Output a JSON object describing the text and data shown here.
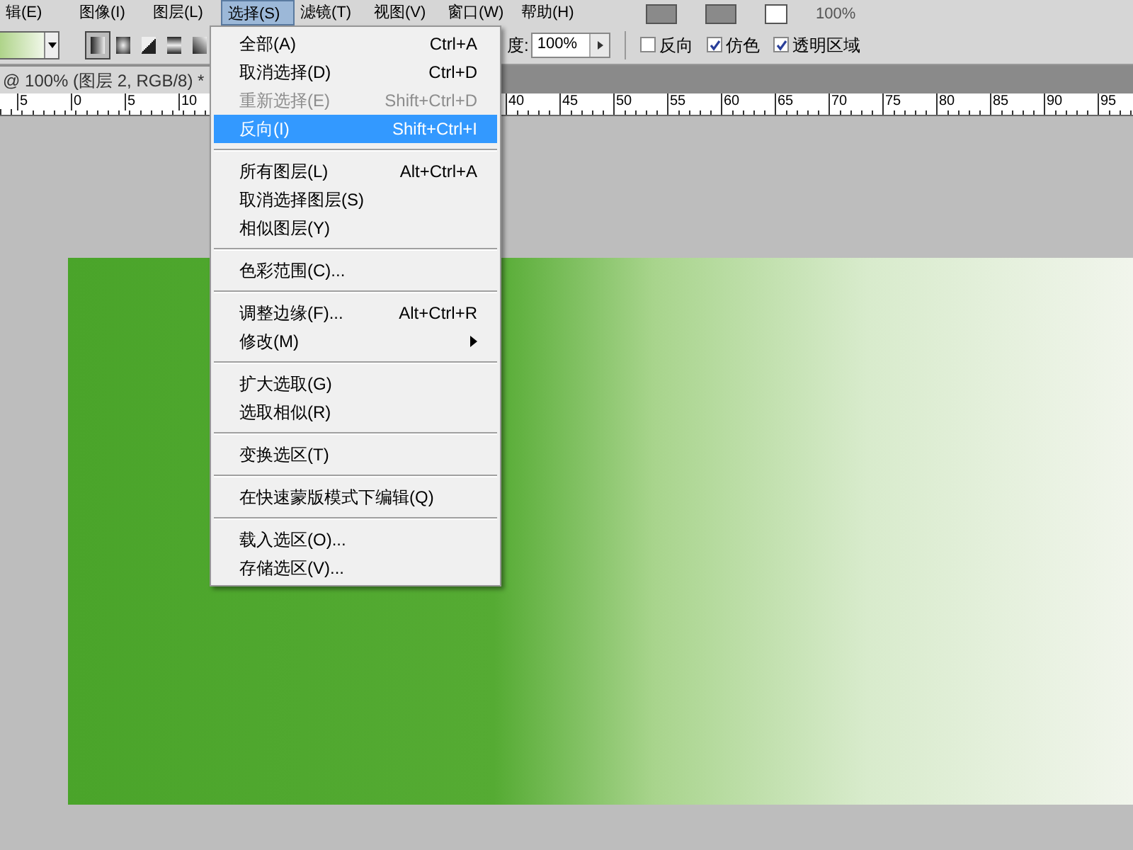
{
  "menu_bar": [
    {
      "label": "辑(E)",
      "selected": false
    },
    {
      "label": "图像(I)",
      "selected": false
    },
    {
      "label": "图层(L)",
      "selected": false
    },
    {
      "label": "选择(S)",
      "selected": true
    },
    {
      "label": "滤镜(T)",
      "selected": false
    },
    {
      "label": "视图(V)",
      "selected": false
    },
    {
      "label": "窗口(W)",
      "selected": false
    },
    {
      "label": "帮助(H)",
      "selected": false
    }
  ],
  "app_bar": {
    "zoom": "100%"
  },
  "options_bar": {
    "opacity_label": "度:",
    "opacity_value": "100%",
    "gradient_types": [
      {
        "selected": true
      },
      {
        "selected": false
      },
      {
        "selected": false
      },
      {
        "selected": false
      },
      {
        "selected": false
      }
    ],
    "checkboxes": [
      {
        "label": "反向",
        "checked": false
      },
      {
        "label": "仿色",
        "checked": true
      },
      {
        "label": "透明区域",
        "checked": true
      }
    ]
  },
  "document_tab": {
    "title": "@ 100% (图层 2, RGB/8) *"
  },
  "ruler": {
    "left_labels": [
      "5",
      "0",
      "5",
      "10"
    ],
    "right_labels": [
      "40",
      "45",
      "50",
      "55",
      "60",
      "65",
      "70",
      "75",
      "80",
      "85",
      "90",
      "95"
    ]
  },
  "select_menu": {
    "groups": [
      [
        {
          "label": "全部(A)",
          "shortcut": "Ctrl+A",
          "disabled": false,
          "selected": false
        },
        {
          "label": "取消选择(D)",
          "shortcut": "Ctrl+D",
          "disabled": false,
          "selected": false
        },
        {
          "label": "重新选择(E)",
          "shortcut": "Shift+Ctrl+D",
          "disabled": true,
          "selected": false
        },
        {
          "label": "反向(I)",
          "shortcut": "Shift+Ctrl+I",
          "disabled": false,
          "selected": true
        }
      ],
      [
        {
          "label": "所有图层(L)",
          "shortcut": "Alt+Ctrl+A",
          "disabled": false,
          "selected": false
        },
        {
          "label": "取消选择图层(S)",
          "disabled": false,
          "selected": false
        },
        {
          "label": "相似图层(Y)",
          "disabled": false,
          "selected": false
        }
      ],
      [
        {
          "label": "色彩范围(C)...",
          "disabled": false,
          "selected": false
        }
      ],
      [
        {
          "label": "调整边缘(F)...",
          "shortcut": "Alt+Ctrl+R",
          "disabled": false,
          "selected": false
        },
        {
          "label": "修改(M)",
          "submenu": true,
          "disabled": false,
          "selected": false
        }
      ],
      [
        {
          "label": "扩大选取(G)",
          "disabled": false,
          "selected": false
        },
        {
          "label": "选取相似(R)",
          "disabled": false,
          "selected": false
        }
      ],
      [
        {
          "label": "变换选区(T)",
          "disabled": false,
          "selected": false
        }
      ],
      [
        {
          "label": "在快速蒙版模式下编辑(Q)",
          "disabled": false,
          "selected": false
        }
      ],
      [
        {
          "label": "载入选区(O)...",
          "disabled": false,
          "selected": false
        },
        {
          "label": "存储选区(V)...",
          "disabled": false,
          "selected": false
        }
      ]
    ]
  }
}
